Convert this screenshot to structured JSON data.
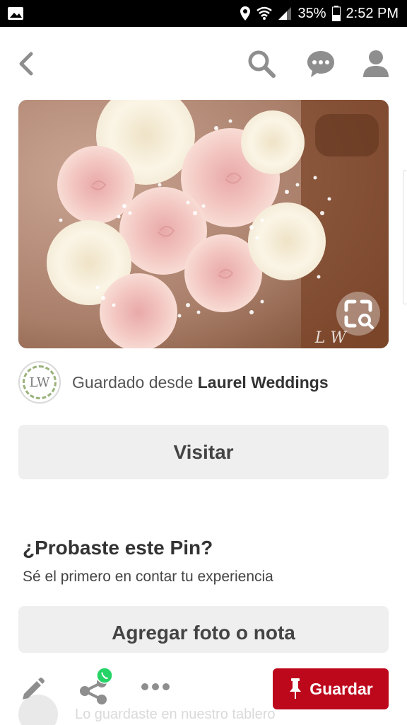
{
  "status_bar": {
    "battery": "35%",
    "time": "2:52 PM"
  },
  "pin": {
    "image_alt": "Ramo de rosas rosadas y blancas con gypsophila",
    "watermark": "L W",
    "source_prefix": "Guardado desde",
    "source_name": "Laurel Weddings",
    "source_avatar_text": "LW",
    "visit_label": "Visitar"
  },
  "tried": {
    "title": "¿Probaste este Pin?",
    "subtitle": "Sé el primero en contar tu experiencia",
    "add_label": "Agregar foto o nota"
  },
  "bottom_bar": {
    "save_label": "Guardar",
    "behind_text": "Lo guardaste en nuestro tablero"
  },
  "icons": {
    "back": "chevron-left-icon",
    "search": "search-icon",
    "messages": "chat-bubble-icon",
    "profile": "user-icon",
    "edit": "pencil-icon",
    "share": "share-icon",
    "whatsapp": "whatsapp-icon",
    "more": "more-dots-icon",
    "pin": "pushpin-icon",
    "lens": "visual-search-icon"
  },
  "colors": {
    "accent": "#bd081c",
    "button_gray": "#efefef"
  }
}
